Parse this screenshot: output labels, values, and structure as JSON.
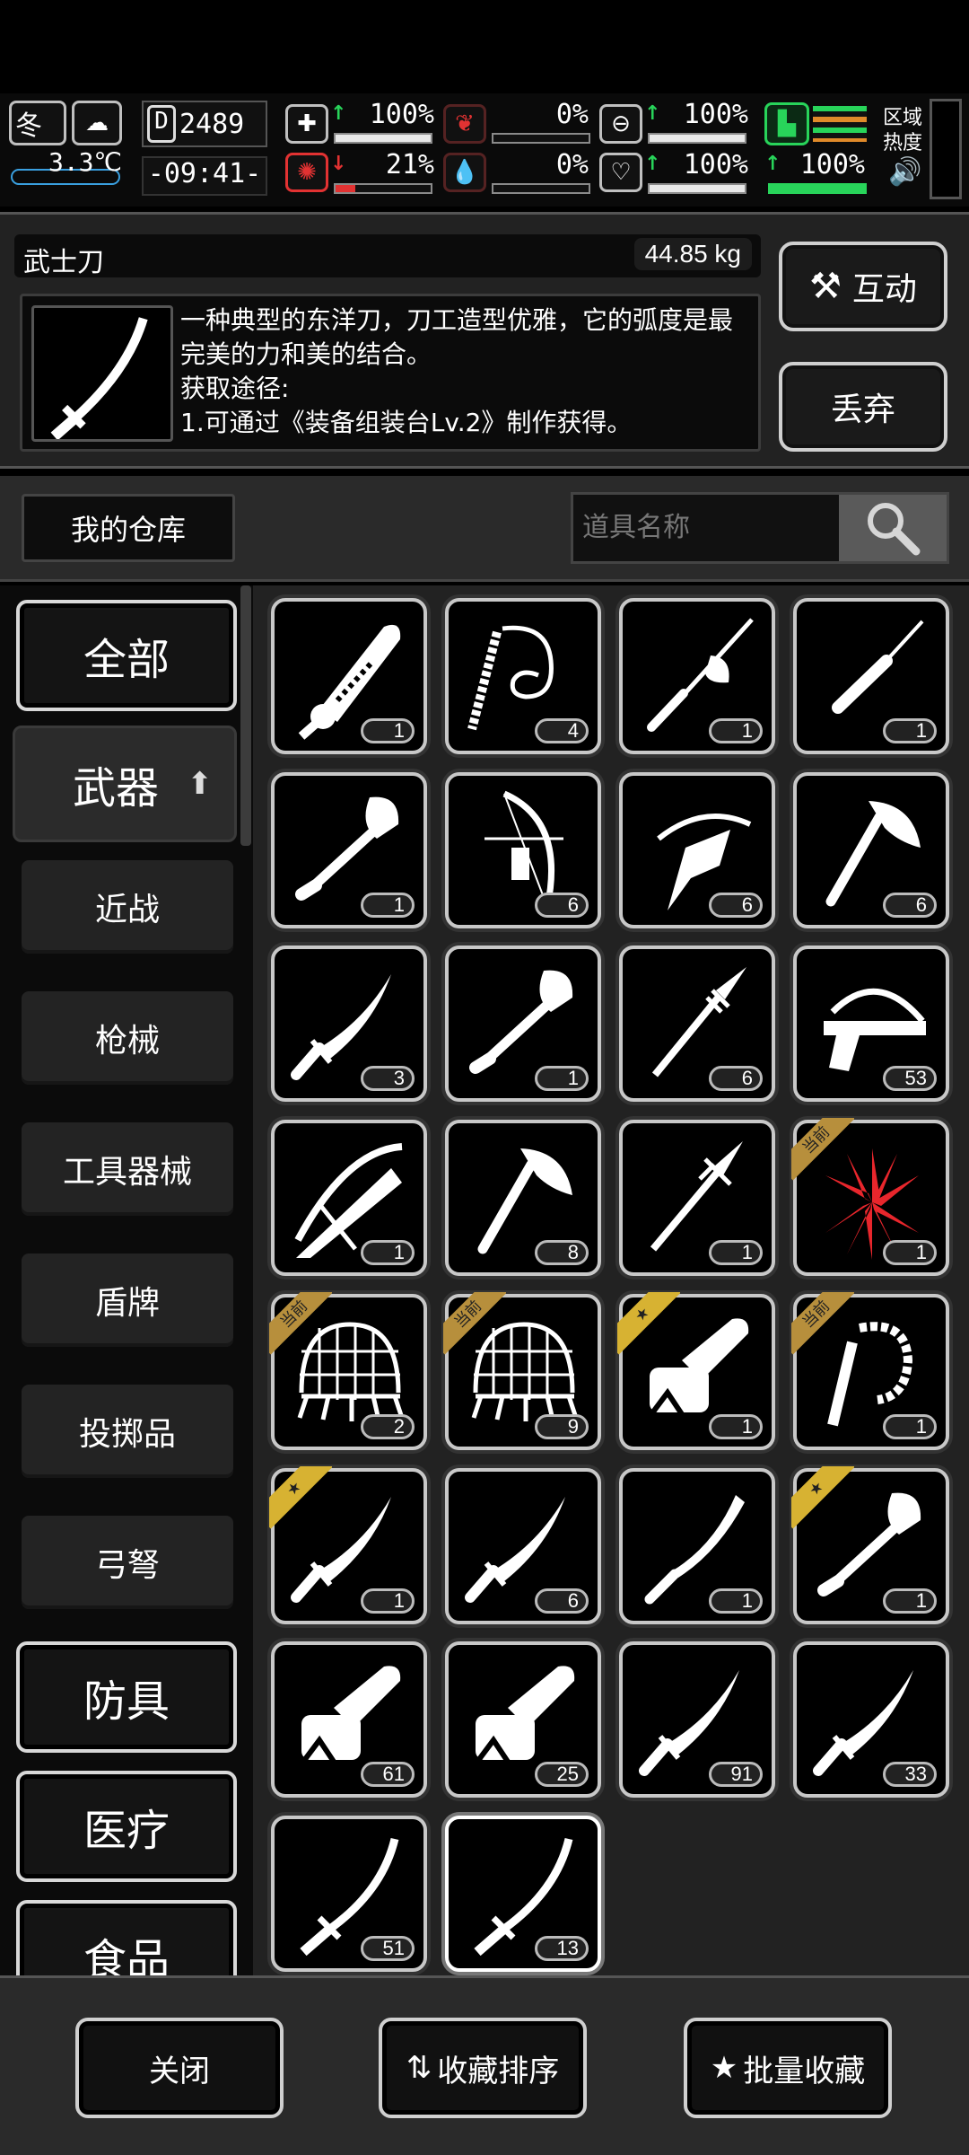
{
  "status": {
    "season": "冬",
    "temperature": "3.3℃",
    "day_counter": "2489",
    "clock": "-09:41-",
    "health_pct": "100%",
    "infection_pct": "21%",
    "hunger_pct": "0%",
    "thirst_pct": "0%",
    "stamina_pct": "100%",
    "mood_pct": "100%",
    "energy_pct": "100%",
    "zone_label": "区域热度"
  },
  "detail": {
    "item_name": "武士刀",
    "weight": "44.85 kg",
    "description": "一种典型的东洋刀，刀工造型优雅，它的弧度是最完美的力和美的结合。",
    "source_label": "获取途径:",
    "source_text": "1.可通过《装备组装台Lv.2》制作获得。",
    "interact_button": "互动",
    "discard_button": "丢弃"
  },
  "warehouse": {
    "tab_label": "我的仓库",
    "search_placeholder": "道具名称"
  },
  "sidebar": {
    "all": "全部",
    "weapons": "武器",
    "melee": "近战",
    "firearms": "枪械",
    "tools": "工具器械",
    "shields": "盾牌",
    "throwables": "投掷品",
    "bows": "弓弩",
    "armor": "防具",
    "medical": "医疗",
    "food": "食品"
  },
  "items": [
    {
      "icon": "chainsaw-sword-icon",
      "count": "1",
      "badge": ""
    },
    {
      "icon": "whip-icon",
      "count": "4",
      "badge": ""
    },
    {
      "icon": "rapier-icon",
      "count": "1",
      "badge": ""
    },
    {
      "icon": "screwdriver-icon",
      "count": "1",
      "badge": ""
    },
    {
      "icon": "shovel-icon",
      "count": "1",
      "badge": ""
    },
    {
      "icon": "compound-bow-icon",
      "count": "6",
      "badge": ""
    },
    {
      "icon": "crossbow-icon",
      "count": "6",
      "badge": ""
    },
    {
      "icon": "axe-icon",
      "count": "6",
      "badge": ""
    },
    {
      "icon": "knife-icon",
      "count": "3",
      "badge": ""
    },
    {
      "icon": "shovel-icon",
      "count": "1",
      "badge": ""
    },
    {
      "icon": "spear-icon",
      "count": "6",
      "badge": ""
    },
    {
      "icon": "pistol-crossbow-icon",
      "count": "53",
      "badge": ""
    },
    {
      "icon": "heavy-crossbow-icon",
      "count": "1",
      "badge": ""
    },
    {
      "icon": "axe-icon",
      "count": "8",
      "badge": ""
    },
    {
      "icon": "trident-spear-icon",
      "count": "1",
      "badge": ""
    },
    {
      "icon": "red-flower-icon",
      "count": "1",
      "badge": "当前"
    },
    {
      "icon": "net-trap-icon",
      "count": "2",
      "badge": "当前"
    },
    {
      "icon": "net-trap-icon",
      "count": "9",
      "badge": "当前"
    },
    {
      "icon": "chainsaw-icon",
      "count": "1",
      "badge": "star"
    },
    {
      "icon": "spine-whip-icon",
      "count": "1",
      "badge": "当前"
    },
    {
      "icon": "knife-icon",
      "count": "1",
      "badge": "star"
    },
    {
      "icon": "knife-icon",
      "count": "6",
      "badge": ""
    },
    {
      "icon": "machete-icon",
      "count": "1",
      "badge": ""
    },
    {
      "icon": "shovel-icon",
      "count": "1",
      "badge": "star"
    },
    {
      "icon": "chainsaw-icon",
      "count": "61",
      "badge": ""
    },
    {
      "icon": "chainsaw-icon",
      "count": "25",
      "badge": ""
    },
    {
      "icon": "knife-icon",
      "count": "91",
      "badge": ""
    },
    {
      "icon": "knife-icon",
      "count": "33",
      "badge": ""
    },
    {
      "icon": "katana-icon",
      "count": "51",
      "badge": ""
    },
    {
      "icon": "katana-icon",
      "count": "13",
      "badge": ""
    }
  ],
  "footer": {
    "close": "关闭",
    "sort": "收藏排序",
    "batch": "批量收藏"
  }
}
